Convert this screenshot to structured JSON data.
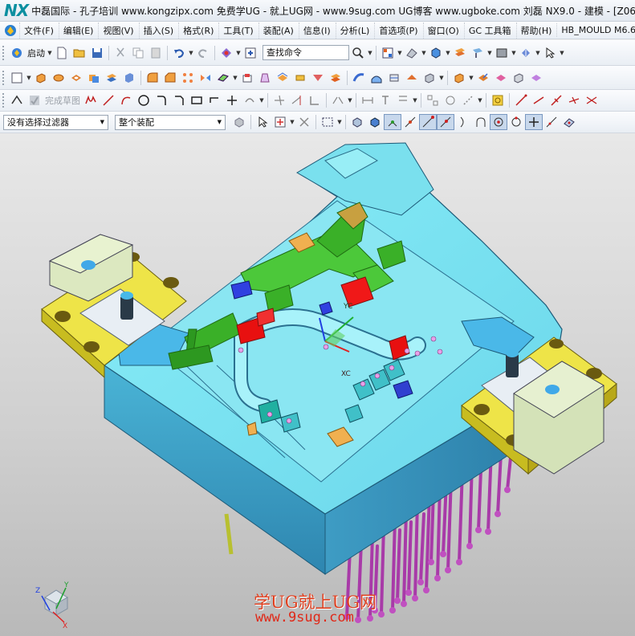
{
  "window": {
    "logo": "NX",
    "title": "中磊国际 - 孔子培训 www.kongzipx.com 免费学UG - 就上UG网 - www.9sug.com  UG博客 www.ugboke.com 刘磊  NX9.0 - 建模 - [Z06"
  },
  "menubar": {
    "items": [
      {
        "label": "文件(F)"
      },
      {
        "label": "编辑(E)"
      },
      {
        "label": "视图(V)"
      },
      {
        "label": "插入(S)"
      },
      {
        "label": "格式(R)"
      },
      {
        "label": "工具(T)"
      },
      {
        "label": "装配(A)"
      },
      {
        "label": "信息(I)"
      },
      {
        "label": "分析(L)"
      },
      {
        "label": "首选项(P)"
      },
      {
        "label": "窗口(O)"
      },
      {
        "label": "GC 工具箱"
      },
      {
        "label": "帮助(H)"
      },
      {
        "label": "HB_MOULD M6.6"
      }
    ]
  },
  "toolbar1": {
    "start_label": "启动",
    "command_search_value": "查找命令"
  },
  "toolbar3": {
    "finish_sketch_label": "完成草图"
  },
  "selection_bar": {
    "filter_value": "没有选择过滤器",
    "scope_value": "整个装配"
  },
  "viewport": {
    "watermark_cn": "学UG就上UG网",
    "watermark_url": "www.9sug.com",
    "triad_labels": {
      "x": "X",
      "y": "Y",
      "z": "Z"
    },
    "csys_labels": {
      "xc": "XC",
      "yc": "YC"
    }
  },
  "colors": {
    "background_top": "#e8e8e8",
    "background_bottom": "#b9b9b9",
    "mold_top": "#7fe6f0",
    "mold_side": "#3aa0c4",
    "clamp_yellow": "#f0e040",
    "insert_green": "#40c030",
    "slider_red": "#f01010",
    "ejector_pins": "#b040b0"
  }
}
